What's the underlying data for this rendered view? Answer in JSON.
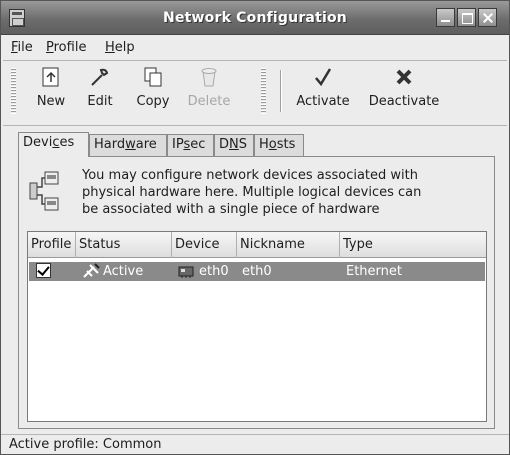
{
  "window": {
    "title": "Network Configuration"
  },
  "menu": [
    {
      "label": "File",
      "mnemonic": "F",
      "rest": "ile"
    },
    {
      "label": "Profile",
      "mnemonic": "P",
      "rest": "rofile"
    },
    {
      "label": "Help",
      "mnemonic": "H",
      "rest": "elp"
    }
  ],
  "toolbar": {
    "new": "New",
    "edit": "Edit",
    "copy": "Copy",
    "delete": "Delete",
    "activate": "Activate",
    "deactivate": "Deactivate"
  },
  "tabs": [
    {
      "label": "Devices",
      "pre": "Devi",
      "mn": "c",
      "post": "es",
      "active": true
    },
    {
      "label": "Hardware",
      "pre": "Hard",
      "mn": "w",
      "post": "are",
      "active": false
    },
    {
      "label": "IPsec",
      "pre": "IP",
      "mn": "s",
      "post": "ec",
      "active": false
    },
    {
      "label": "DNS",
      "pre": "D",
      "mn": "N",
      "post": "S",
      "active": false
    },
    {
      "label": "Hosts",
      "pre": "H",
      "mn": "o",
      "post": "sts",
      "active": false
    }
  ],
  "info": {
    "line1": "You may configure network devices associated with",
    "line2": "physical hardware here.  Multiple logical devices can",
    "line3": "be associated with a single piece of hardware"
  },
  "table": {
    "columns": [
      "Profile",
      "Status",
      "Device",
      "Nickname",
      "Type"
    ],
    "rows": [
      {
        "profile_checked": true,
        "status": "Active",
        "device": "eth0",
        "nickname": "eth0",
        "type": "Ethernet"
      }
    ]
  },
  "status": {
    "text": "Active profile: Common"
  },
  "colors": {
    "selection": "#8a8a8a",
    "title_bar": "#6d6d6d"
  },
  "icons": [
    "app-icon",
    "new-icon",
    "edit-icon",
    "copy-icon",
    "delete-icon",
    "activate-icon",
    "deactivate-icon",
    "network-devices-icon",
    "active-status-icon",
    "network-card-icon"
  ]
}
